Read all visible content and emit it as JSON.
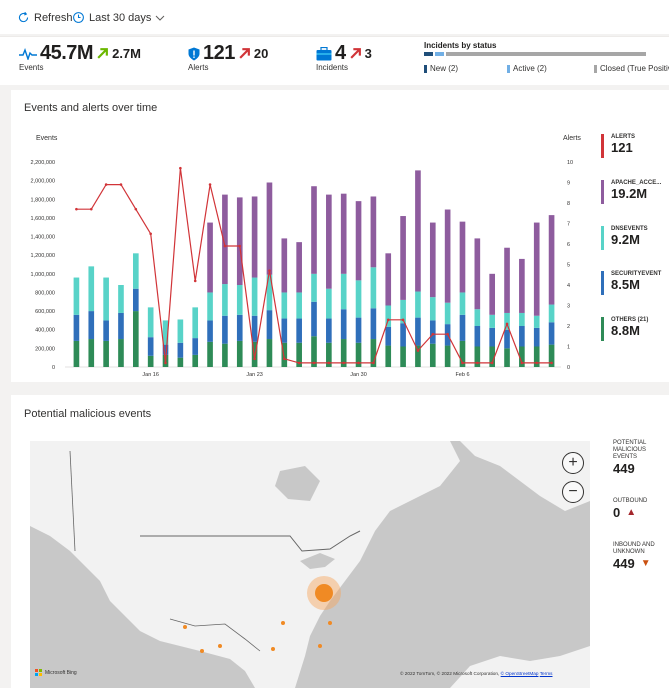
{
  "toolbar": {
    "refresh_label": "Refresh",
    "range_label": "Last 30 days"
  },
  "kpis": [
    {
      "value": "45.7M",
      "delta": "2.7M",
      "label": "Events",
      "icon": "activity-icon",
      "arrow_color": "#6bb700"
    },
    {
      "value": "121",
      "delta": "20",
      "label": "Alerts",
      "icon": "shield-icon",
      "arrow_color": "#d13438"
    },
    {
      "value": "4",
      "delta": "3",
      "label": "Incidents",
      "icon": "briefcase-icon",
      "arrow_color": "#d13438"
    }
  ],
  "incidents_status": {
    "title": "Incidents by status",
    "items": [
      "New (2)",
      "Active (2)",
      "Closed (True Positiv"
    ],
    "colors": [
      "#1f4e79",
      "#71afe5",
      "#a6a6a6"
    ]
  },
  "events_panel": {
    "title": "Events and alerts over time"
  },
  "chart_data": {
    "type": "bar",
    "ylabel": "Events",
    "y2label": "Alerts",
    "ylim": [
      0,
      2200000
    ],
    "y2lim": [
      0,
      10
    ],
    "y_ticks": [
      "2,200,000",
      "2,000,000",
      "1,800,000",
      "1,600,000",
      "1,400,000",
      "1,200,000",
      "1,000,000",
      "800,000",
      "600,000",
      "400,000",
      "200,000",
      "0"
    ],
    "y2_ticks": [
      "10",
      "9",
      "8",
      "7",
      "6",
      "5",
      "4",
      "3",
      "2",
      "1",
      "0"
    ],
    "x_tick_labels": [
      {
        "index": 5,
        "label": "Jan 16"
      },
      {
        "index": 12,
        "label": "Jan 23"
      },
      {
        "index": 19,
        "label": "Jan 30"
      },
      {
        "index": 26,
        "label": "Feb 6"
      }
    ],
    "series_colors": {
      "others": "#2e8b57",
      "securityevent": "#2f6fba",
      "dnsevents": "#58d3c8",
      "apache": "#8e5c9e",
      "alerts": "#d13438"
    },
    "stacks": [
      {
        "others": 280000,
        "securityevent": 280000,
        "dnsevents": 400000,
        "apache": 0
      },
      {
        "others": 300000,
        "securityevent": 300000,
        "dnsevents": 480000,
        "apache": 0
      },
      {
        "others": 280000,
        "securityevent": 220000,
        "dnsevents": 460000,
        "apache": 0
      },
      {
        "others": 300000,
        "securityevent": 280000,
        "dnsevents": 300000,
        "apache": 0
      },
      {
        "others": 600000,
        "securityevent": 240000,
        "dnsevents": 380000,
        "apache": 0
      },
      {
        "others": 120000,
        "securityevent": 200000,
        "dnsevents": 320000,
        "apache": 0
      },
      {
        "others": 130000,
        "securityevent": 110000,
        "dnsevents": 260000,
        "apache": 0
      },
      {
        "others": 100000,
        "securityevent": 160000,
        "dnsevents": 250000,
        "apache": 0
      },
      {
        "others": 130000,
        "securityevent": 180000,
        "dnsevents": 330000,
        "apache": 0
      },
      {
        "others": 270000,
        "securityevent": 230000,
        "dnsevents": 300000,
        "apache": 750000
      },
      {
        "others": 250000,
        "securityevent": 300000,
        "dnsevents": 340000,
        "apache": 960000
      },
      {
        "others": 280000,
        "securityevent": 280000,
        "dnsevents": 320000,
        "apache": 940000
      },
      {
        "others": 270000,
        "securityevent": 280000,
        "dnsevents": 410000,
        "apache": 870000
      },
      {
        "others": 300000,
        "securityevent": 310000,
        "dnsevents": 380000,
        "apache": 990000
      },
      {
        "others": 260000,
        "securityevent": 260000,
        "dnsevents": 280000,
        "apache": 580000
      },
      {
        "others": 260000,
        "securityevent": 260000,
        "dnsevents": 280000,
        "apache": 540000
      },
      {
        "others": 330000,
        "securityevent": 370000,
        "dnsevents": 300000,
        "apache": 940000
      },
      {
        "others": 260000,
        "securityevent": 260000,
        "dnsevents": 320000,
        "apache": 1010000
      },
      {
        "others": 300000,
        "securityevent": 320000,
        "dnsevents": 380000,
        "apache": 860000
      },
      {
        "others": 260000,
        "securityevent": 270000,
        "dnsevents": 400000,
        "apache": 850000
      },
      {
        "others": 300000,
        "securityevent": 330000,
        "dnsevents": 440000,
        "apache": 760000
      },
      {
        "others": 230000,
        "securityevent": 200000,
        "dnsevents": 230000,
        "apache": 560000
      },
      {
        "others": 220000,
        "securityevent": 250000,
        "dnsevents": 250000,
        "apache": 900000
      },
      {
        "others": 230000,
        "securityevent": 300000,
        "dnsevents": 280000,
        "apache": 1300000
      },
      {
        "others": 250000,
        "securityevent": 250000,
        "dnsevents": 250000,
        "apache": 800000
      },
      {
        "others": 230000,
        "securityevent": 230000,
        "dnsevents": 230000,
        "apache": 1000000
      },
      {
        "others": 280000,
        "securityevent": 280000,
        "dnsevents": 240000,
        "apache": 760000
      },
      {
        "others": 220000,
        "securityevent": 220000,
        "dnsevents": 180000,
        "apache": 760000
      },
      {
        "others": 220000,
        "securityevent": 200000,
        "dnsevents": 140000,
        "apache": 440000
      },
      {
        "others": 200000,
        "securityevent": 200000,
        "dnsevents": 180000,
        "apache": 700000
      },
      {
        "others": 220000,
        "securityevent": 220000,
        "dnsevents": 140000,
        "apache": 580000
      },
      {
        "others": 220000,
        "securityevent": 200000,
        "dnsevents": 130000,
        "apache": 1000000
      },
      {
        "others": 240000,
        "securityevent": 240000,
        "dnsevents": 190000,
        "apache": 960000
      }
    ],
    "alerts": [
      7.7,
      7.7,
      8.9,
      8.9,
      7.7,
      6.5,
      0.2,
      9.7,
      4.2,
      8.9,
      5.9,
      5.9,
      0.4,
      4.7,
      0.4,
      0.2,
      0.2,
      0.2,
      0.2,
      0.2,
      0.2,
      2.3,
      2.3,
      0.8,
      1.6,
      1.6,
      0.2,
      0.2,
      0.2,
      2.1,
      0.2,
      0.2,
      0.2
    ],
    "legend": [
      {
        "name": "ALERTS",
        "value": "121",
        "color": "#d13438"
      },
      {
        "name": "APACHE_ACCE...",
        "value": "19.2M",
        "color": "#8e5c9e"
      },
      {
        "name": "DNSEVENTS",
        "value": "9.2M",
        "color": "#58d3c8"
      },
      {
        "name": "SECURITYEVENT",
        "value": "8.5M",
        "color": "#2f6fba"
      },
      {
        "name": "OTHERS (21)",
        "value": "8.8M",
        "color": "#2e8b57"
      }
    ]
  },
  "map_panel": {
    "title": "Potential malicious events",
    "zoom_in": "+",
    "zoom_out": "−",
    "bing_label": "Microsoft Bing",
    "attribution": "© 2022 TomTom, © 2022 Microsoft Corporation,",
    "osm_link": "© OpenStreetMap",
    "terms_link": "Terms",
    "stats": [
      {
        "label": "POTENTIAL MALICIOUS EVENTS",
        "value": "449",
        "arrow": ""
      },
      {
        "label": "OUTBOUND",
        "value": "0",
        "arrow": "▲",
        "arrow_color": "#a4262c"
      },
      {
        "label": "INBOUND AND UNKNOWN",
        "value": "449",
        "arrow": "▼",
        "arrow_color": "#ca5010"
      }
    ]
  }
}
